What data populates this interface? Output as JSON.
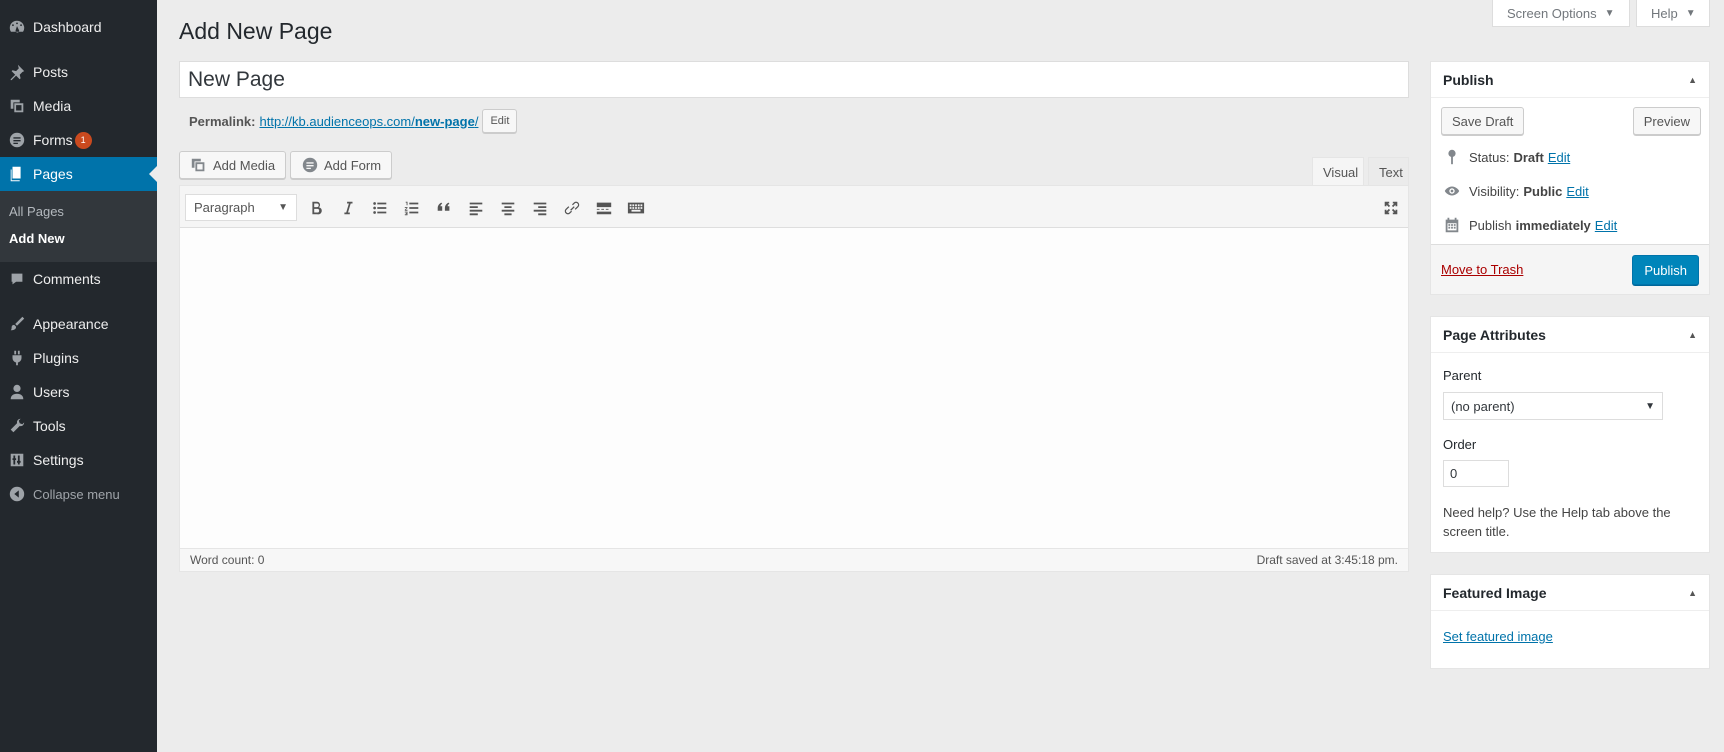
{
  "sidebar": {
    "items": [
      {
        "label": "Dashboard",
        "icon": "dashboard-icon"
      },
      {
        "label": "Posts",
        "icon": "pin-icon"
      },
      {
        "label": "Media",
        "icon": "media-icon"
      },
      {
        "label": "Forms",
        "icon": "forms-icon",
        "badge": "1"
      },
      {
        "label": "Pages",
        "icon": "pages-icon"
      },
      {
        "label": "Comments",
        "icon": "comment-icon"
      },
      {
        "label": "Appearance",
        "icon": "paintbrush-icon"
      },
      {
        "label": "Plugins",
        "icon": "plugin-icon"
      },
      {
        "label": "Users",
        "icon": "user-icon"
      },
      {
        "label": "Tools",
        "icon": "wrench-icon"
      },
      {
        "label": "Settings",
        "icon": "settings-icon"
      },
      {
        "label": "Collapse menu",
        "icon": "collapse-icon"
      }
    ],
    "submenu": [
      "All Pages",
      "Add New"
    ]
  },
  "top": {
    "screen_options": "Screen Options",
    "help": "Help"
  },
  "main": {
    "page_title": "Add New Page",
    "title_value": "New Page",
    "permalink_label": "Permalink:",
    "permalink_base": "http://kb.audienceops.com/",
    "permalink_slug": "new-page",
    "permalink_trail": "/",
    "permalink_edit": "Edit",
    "add_media": "Add Media",
    "add_form": "Add Form",
    "tab_visual": "Visual",
    "tab_text": "Text",
    "format_value": "Paragraph",
    "word_count": "Word count: 0",
    "draft_saved": "Draft saved at 3:45:18 pm."
  },
  "publish": {
    "title": "Publish",
    "save_draft": "Save Draft",
    "preview": "Preview",
    "status_label": "Status:",
    "status_value": "Draft",
    "visibility_label": "Visibility:",
    "visibility_value": "Public",
    "publish_label": "Publish",
    "publish_value": "immediately",
    "edit": "Edit",
    "move_to_trash": "Move to Trash",
    "publish_button": "Publish"
  },
  "page_attributes": {
    "title": "Page Attributes",
    "parent_label": "Parent",
    "parent_value": "(no parent)",
    "order_label": "Order",
    "order_value": "0",
    "help_text": "Need help? Use the Help tab above the screen title."
  },
  "featured_image": {
    "title": "Featured Image",
    "link": "Set featured image"
  },
  "colors": {
    "sidebar_bg": "#23282d",
    "accent": "#0073aa",
    "publish_button": "#0085ba",
    "badge": "#ca4a1f",
    "trash_link": "#a00"
  }
}
